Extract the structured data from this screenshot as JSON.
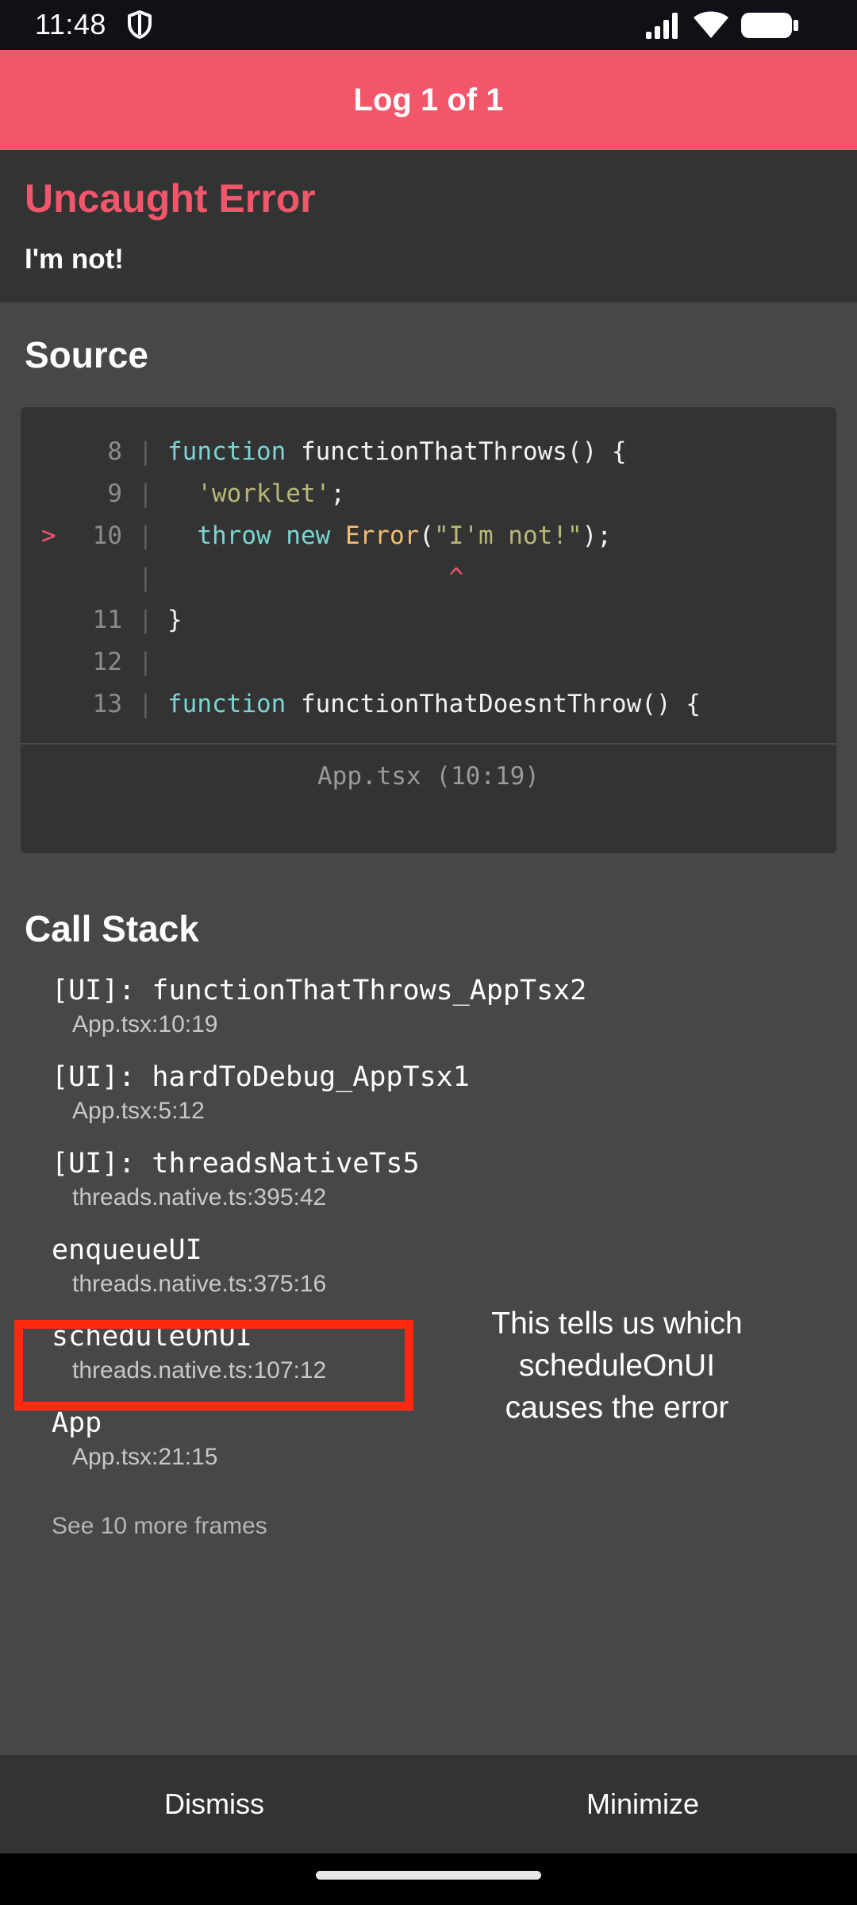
{
  "status_bar": {
    "time": "11:48",
    "icons": [
      "shield-icon",
      "signal-icon",
      "wifi-icon",
      "battery-icon"
    ]
  },
  "header": {
    "title": "Log 1 of 1"
  },
  "error": {
    "title": "Uncaught Error",
    "message": "I'm not!"
  },
  "source": {
    "title": "Source",
    "lines": [
      {
        "marker": "",
        "num": "8",
        "tokens": [
          [
            "kw",
            "function"
          ],
          [
            "id",
            " functionThatThrows() {"
          ]
        ]
      },
      {
        "marker": "",
        "num": "9",
        "tokens": [
          [
            "id",
            "  "
          ],
          [
            "str",
            "'worklet'"
          ],
          [
            "id",
            ";"
          ]
        ]
      },
      {
        "marker": ">",
        "num": "10",
        "tokens": [
          [
            "id",
            "  "
          ],
          [
            "kw",
            "throw new "
          ],
          [
            "cls",
            "Error"
          ],
          [
            "id",
            "("
          ],
          [
            "str",
            "\"I'm not!\""
          ],
          [
            "id",
            ");"
          ]
        ]
      },
      {
        "marker": "",
        "num": "",
        "tokens": [
          [
            "caret",
            "                   ^"
          ]
        ]
      },
      {
        "marker": "",
        "num": "11",
        "tokens": [
          [
            "id",
            "}"
          ]
        ]
      },
      {
        "marker": "",
        "num": "12",
        "tokens": []
      },
      {
        "marker": "",
        "num": "13",
        "tokens": [
          [
            "kw",
            "function"
          ],
          [
            "id",
            " functionThatDoesntThrow() {"
          ]
        ]
      }
    ],
    "location": "App.tsx (10:19)"
  },
  "call_stack": {
    "title": "Call Stack",
    "frames": [
      {
        "name": "[UI]: functionThatThrows_AppTsx2",
        "location": "App.tsx:10:19"
      },
      {
        "name": "[UI]: hardToDebug_AppTsx1",
        "location": "App.tsx:5:12"
      },
      {
        "name": "[UI]: threadsNativeTs5",
        "location": "threads.native.ts:395:42"
      },
      {
        "name": "enqueueUI",
        "location": "threads.native.ts:375:16"
      },
      {
        "name": "scheduleOnUI",
        "location": "threads.native.ts:107:12"
      },
      {
        "name": "App",
        "location": "App.tsx:21:15"
      }
    ],
    "see_more": "See 10 more frames"
  },
  "annotation": {
    "lines": [
      "This tells us which",
      "scheduleOnUI",
      "causes the error"
    ],
    "highlight_color": "#ff2a10"
  },
  "bottom_bar": {
    "dismiss_label": "Dismiss",
    "minimize_label": "Minimize"
  },
  "colors": {
    "accent": "#f2566b",
    "background": "#474747",
    "panel": "#333333"
  }
}
